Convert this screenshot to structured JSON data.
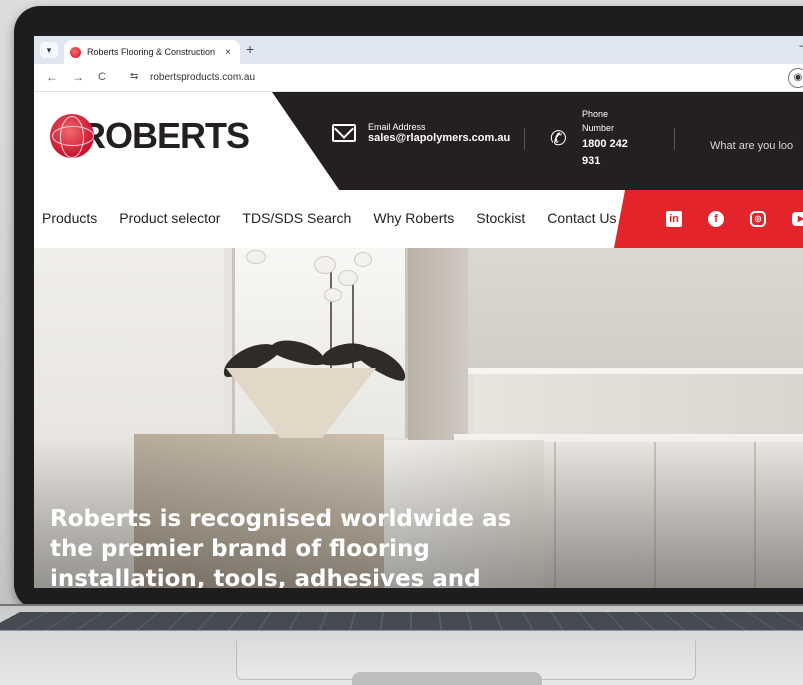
{
  "browser": {
    "tab_title": "Roberts Flooring & Construction",
    "tab_close": "×",
    "new_tab": "+",
    "minimize": "–",
    "url": "robertsproducts.com.au",
    "back": "←",
    "forward": "→",
    "reload": "C",
    "site_info": "⇆",
    "profile": "◉"
  },
  "header": {
    "logo_text": "ROBERTS",
    "email_label": "Email Address",
    "email_value": "sales@rlapolymers.com.au",
    "phone_label_1": "Phone",
    "phone_label_2": "Number",
    "phone_value_1": "1800 242",
    "phone_value_2": "931",
    "search_hint": "What are you loo"
  },
  "nav": {
    "items": [
      "Products",
      "Product selector",
      "TDS/SDS Search",
      "Why Roberts",
      "Stockist",
      "Contact Us"
    ]
  },
  "social": {
    "linkedin": "in",
    "facebook": "f",
    "instagram": "◎",
    "youtube": "▶"
  },
  "hero": {
    "line_1": "Roberts is recognised worldwide as",
    "line_2": "the premier brand of flooring",
    "line_3": "installation, tools, adhesives and"
  },
  "colors": {
    "brand_red": "#e3242b",
    "header_dark": "#241f23"
  }
}
